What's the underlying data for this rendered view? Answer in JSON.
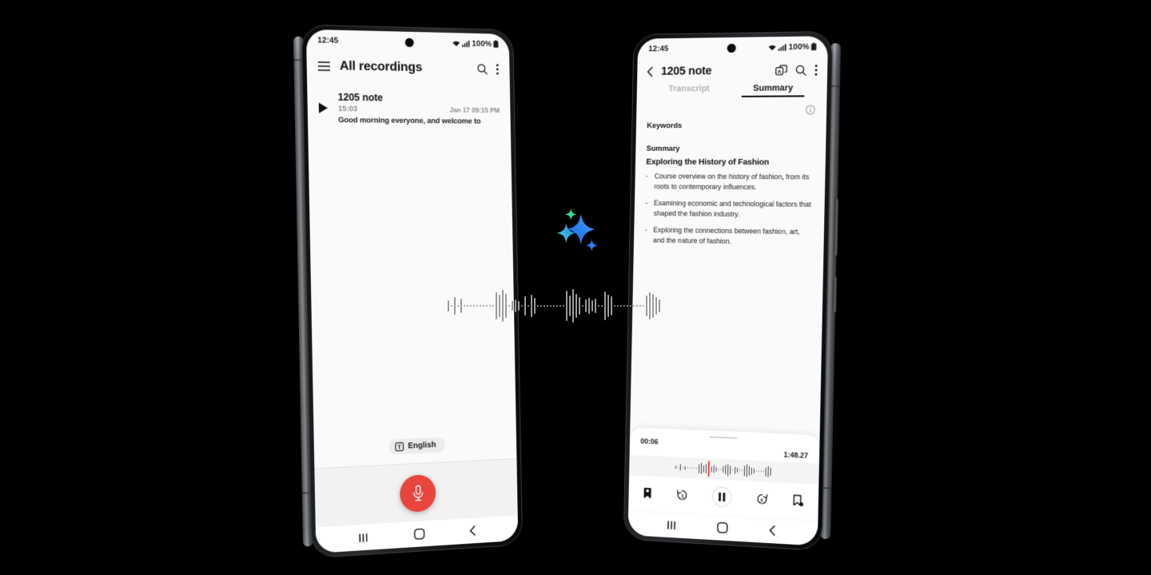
{
  "background_color": "#000000",
  "accent_colors": {
    "record_red": "#E8453C",
    "playhead_red": "#E8453C",
    "sparkle_blue": "#2B7FEE",
    "sparkle_cyan": "#3FD6D6",
    "sparkle_green": "#36D9A8"
  },
  "left_phone": {
    "name": "voice-recorder-list-screen",
    "status_bar": {
      "time": "12:45",
      "wifi_icon": "wifi-icon",
      "signal_icon": "signal-bars-icon",
      "battery_percent": "100%",
      "battery_icon": "battery-full-icon"
    },
    "app_bar": {
      "menu_icon": "hamburger-menu-icon",
      "title": "All recordings",
      "search_icon": "search-icon",
      "more_icon": "more-vertical-icon"
    },
    "recordings": [
      {
        "play_icon": "play-triangle-icon",
        "name": "1205 note",
        "duration": "15:03",
        "date": "Jan 17 09:15 PM",
        "snippet": "Good morning everyone, and welcome to"
      }
    ],
    "language_chip": {
      "icon": "text-language-icon",
      "label": "English"
    },
    "record_button": {
      "icon": "microphone-icon",
      "label": "Record"
    },
    "nav_bar": {
      "recents": "recents-icon",
      "home": "home-icon",
      "back": "back-icon"
    }
  },
  "right_phone": {
    "name": "voice-recorder-summary-screen",
    "status_bar": {
      "time": "12:45",
      "wifi_icon": "wifi-icon",
      "signal_icon": "signal-bars-icon",
      "battery_percent": "100%",
      "battery_icon": "battery-full-icon"
    },
    "app_bar": {
      "back_icon": "chevron-left-icon",
      "title": "1205 note",
      "translate_icon": "translate-icon",
      "search_icon": "search-icon",
      "more_icon": "more-vertical-icon"
    },
    "tabs": [
      {
        "label": "Transcript",
        "active": false
      },
      {
        "label": "Summary",
        "active": true
      }
    ],
    "info_icon": "info-circle-icon",
    "sections": {
      "keywords_label": "Keywords",
      "summary_label": "Summary",
      "summary_heading": "Exploring the History of Fashion",
      "bullet_marker": "-",
      "bullets": [
        "Course overview on the history of fashion, from its roots to contemporary influences.",
        "Examining economic and technological factors that shaped the fashion industry.",
        "Exploring the connections between fashion, art, and the nature of fashion."
      ]
    },
    "player": {
      "current_time": "00:06",
      "total_time": "1:48.27",
      "controls": [
        {
          "name": "bookmark-icon",
          "label": "Bookmark"
        },
        {
          "name": "rewind-5-icon",
          "label": "Rewind 5 seconds"
        },
        {
          "name": "pause-icon",
          "label": "Pause"
        },
        {
          "name": "forward-5-icon",
          "label": "Forward 5 seconds"
        },
        {
          "name": "add-bookmark-icon",
          "label": "Add bookmark"
        }
      ]
    },
    "nav_bar": {
      "recents": "recents-icon",
      "home": "home-icon",
      "back": "back-icon"
    }
  },
  "center_graphic": {
    "sparkle_icon": "ai-sparkle-icon",
    "waveform_icon": "audio-waveform-icon"
  }
}
